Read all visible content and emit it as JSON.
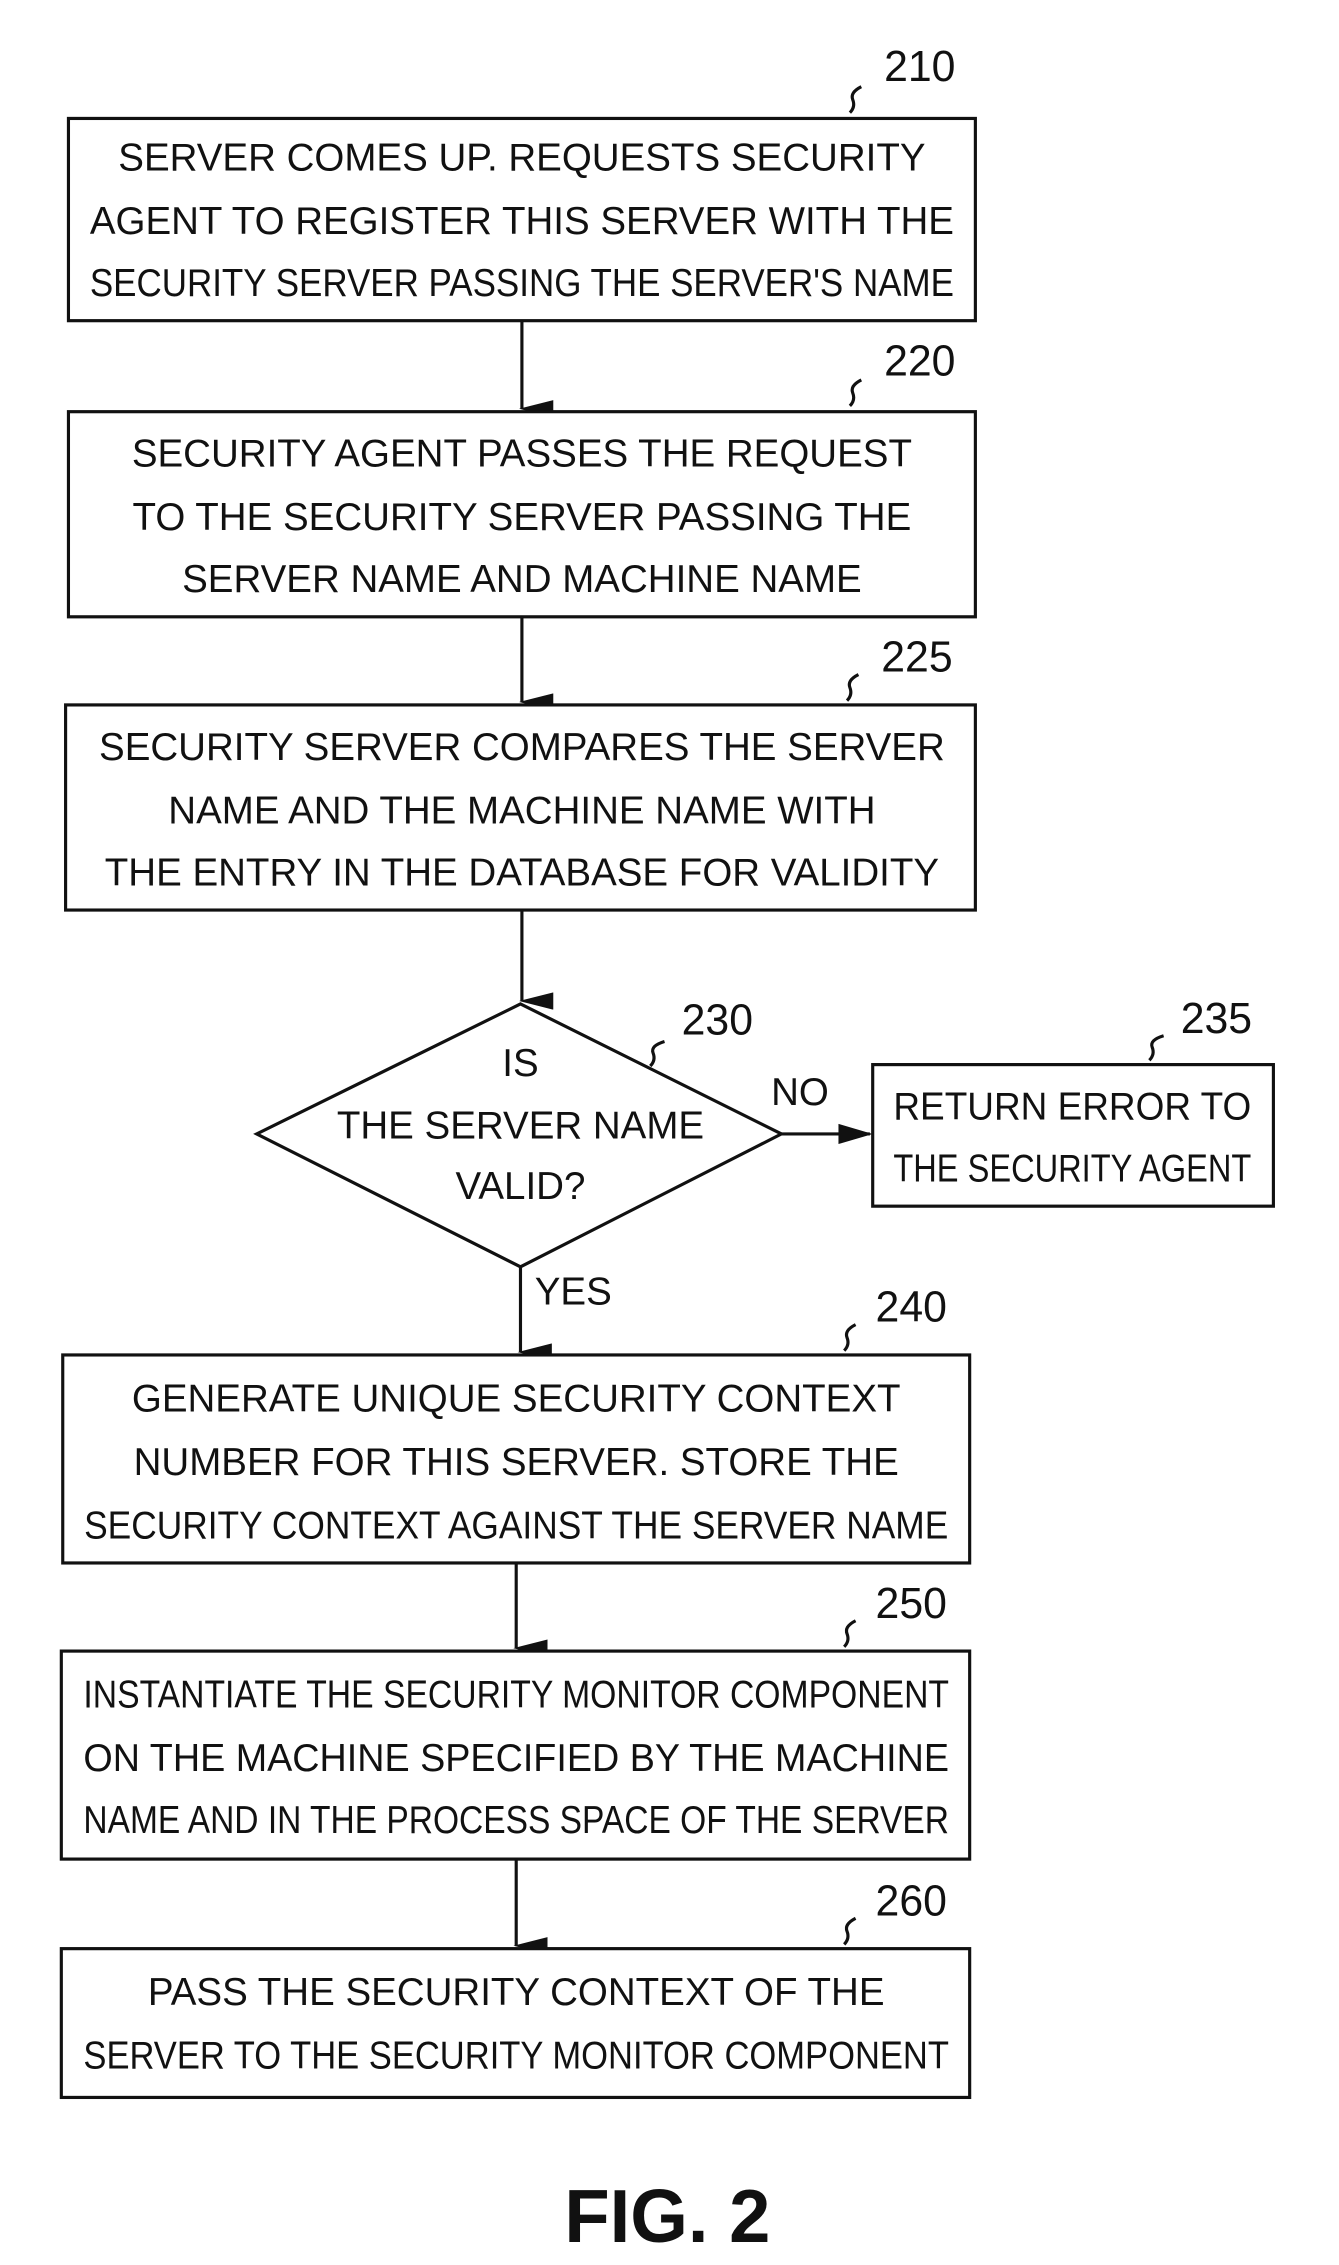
{
  "figure": {
    "caption": "FIG. 2",
    "steps": [
      {
        "id": "210",
        "type": "process",
        "lines": [
          "SERVER COMES UP. REQUESTS SECURITY",
          "AGENT TO REGISTER THIS SERVER WITH THE",
          "SECURITY SERVER PASSING THE SERVER'S NAME"
        ]
      },
      {
        "id": "220",
        "type": "process",
        "lines": [
          "SECURITY AGENT PASSES THE REQUEST",
          "TO THE SECURITY SERVER PASSING THE",
          "SERVER NAME AND MACHINE NAME"
        ]
      },
      {
        "id": "225",
        "type": "process",
        "lines": [
          "SECURITY SERVER COMPARES THE SERVER",
          "NAME AND THE MACHINE NAME WITH",
          "THE ENTRY IN THE DATABASE FOR VALIDITY"
        ]
      },
      {
        "id": "230",
        "type": "decision",
        "lines": [
          "IS",
          "THE SERVER NAME",
          "VALID?"
        ]
      },
      {
        "id": "235",
        "type": "process",
        "lines": [
          "RETURN ERROR TO",
          "THE SECURITY AGENT"
        ]
      },
      {
        "id": "240",
        "type": "process",
        "lines": [
          "GENERATE UNIQUE SECURITY CONTEXT",
          "NUMBER FOR THIS SERVER. STORE THE",
          "SECURITY CONTEXT AGAINST THE SERVER NAME"
        ]
      },
      {
        "id": "250",
        "type": "process",
        "lines": [
          "INSTANTIATE THE SECURITY MONITOR COMPONENT",
          "ON THE MACHINE SPECIFIED BY THE MACHINE",
          "NAME AND IN THE PROCESS SPACE OF THE SERVER"
        ]
      },
      {
        "id": "260",
        "type": "process",
        "lines": [
          "PASS THE SECURITY CONTEXT OF THE",
          "SERVER TO THE SECURITY MONITOR COMPONENT"
        ]
      }
    ],
    "edges": [
      {
        "from": "210",
        "to": "220",
        "label": ""
      },
      {
        "from": "220",
        "to": "225",
        "label": ""
      },
      {
        "from": "225",
        "to": "230",
        "label": ""
      },
      {
        "from": "230",
        "to": "235",
        "label": "NO"
      },
      {
        "from": "230",
        "to": "240",
        "label": "YES"
      },
      {
        "from": "240",
        "to": "250",
        "label": ""
      },
      {
        "from": "250",
        "to": "260",
        "label": ""
      }
    ]
  }
}
